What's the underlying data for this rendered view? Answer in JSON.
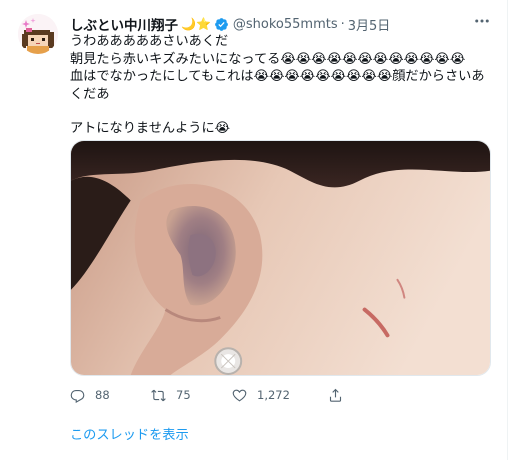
{
  "tweet": {
    "display_name": "しぶとい中川翔子",
    "name_emoji": "🌙⭐",
    "handle": "@shoko55mmts",
    "separator": "·",
    "time": "3月5日",
    "lines": [
      "うわあああああさいあくだ",
      "朝見たら赤いキズみたいになってる😭😭😭😭😭😭😭😭😭😭😭😭",
      "血はでなかったにしてもこれは😭😭😭😭😭😭😭😭😭顔だからさいあくだあ",
      "アトになりませんように😭"
    ],
    "reply_count": "88",
    "retweet_count": "75",
    "like_count": "1,272",
    "show_thread": "このスレッドを表示"
  },
  "colors": {
    "text": "#0f1419",
    "secondary": "#536471",
    "link": "#1d9bf0",
    "verified": "#1d9bf0"
  },
  "icons": {
    "more": "more-horizontal-icon",
    "verified": "verified-badge-icon",
    "reply": "reply-icon",
    "retweet": "retweet-icon",
    "like": "heart-icon",
    "share": "share-icon"
  }
}
